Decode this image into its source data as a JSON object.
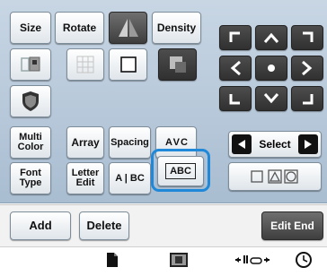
{
  "toolbar": {
    "size_label": "Size",
    "rotate_label": "Rotate",
    "density_label": "Density",
    "multi_color_line1": "Multi",
    "multi_color_line2": "Color",
    "array_label": "Array",
    "spacing_label": "Spacing",
    "kerning_label": "A V C",
    "font_type_line1": "Font",
    "font_type_line2": "Type",
    "letter_edit_line1": "Letter",
    "letter_edit_line2": "Edit",
    "split_label": "A | BC",
    "abc_label": "ABC"
  },
  "select": {
    "label": "Select"
  },
  "actions": {
    "add_label": "Add",
    "delete_label": "Delete",
    "edit_end_label": "Edit End"
  },
  "colors": {
    "panel": "#b8c9da",
    "highlight": "#1f88d8",
    "dark_button": "#3b3b3b"
  },
  "icons": {
    "mirror": "mirror-icon",
    "frame_preview": "frame-preview-icon",
    "grid": "grid-icon",
    "outline_square": "outline-square-icon",
    "shadow_square": "shadow-square-icon",
    "shield": "shield-icon",
    "shapes": "shapes-icon",
    "page": "page-icon",
    "thread": "thread-icon",
    "presser_foot": "presser-foot-icon",
    "clock": "clock-icon"
  }
}
